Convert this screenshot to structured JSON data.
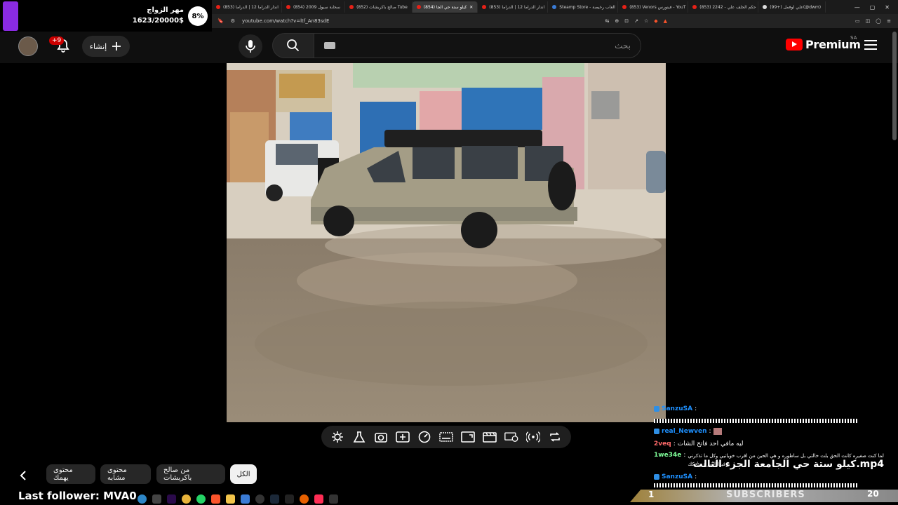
{
  "browser": {
    "tabs": [
      {
        "label": "(853) اندار الدراما 12 | الدراما",
        "active": false
      },
      {
        "label": "(854) سحابة سيول 2009",
        "active": false
      },
      {
        "label": "(852) صالح باكربشات Tube",
        "active": false
      },
      {
        "label": "(854) كيلو ستة حي الجا",
        "active": true
      },
      {
        "label": "(853) اندار الدراما 12 | الدراما",
        "active": false
      },
      {
        "label": "Steamp Store - العاب رخيصة",
        "active": false
      },
      {
        "label": "(853) Venors فينورس - YouT",
        "active": false
      },
      {
        "label": "(853) 2242 - حكم الحلف علي",
        "active": false
      },
      {
        "label": "(99+) علي لوفمل(@dwm)",
        "active": false
      }
    ],
    "url": "youtube.com/watch?v=ltf_An83sdE"
  },
  "widget": {
    "title": "مهر الزواج",
    "value": "1623/20000$",
    "percent": "8%",
    "progress": 0.08,
    "accent": "#8a2be2"
  },
  "youtube": {
    "notification_count": "+9",
    "create_label": "إنشاء",
    "search_placeholder": "بحث",
    "logo_text": "Premium",
    "country_code": "SA",
    "brand_color": "#ff0000"
  },
  "controls": {
    "icons": [
      "settings-icon",
      "flask-icon",
      "camera-icon",
      "add-clip-icon",
      "speed-icon",
      "caption-icon",
      "aspect-icon",
      "film-icon",
      "display-settings-icon",
      "broadcast-icon",
      "loop-icon"
    ]
  },
  "chips": {
    "items": [
      {
        "label": "الكل",
        "active": true
      },
      {
        "label": "من صالح باكربشات",
        "active": false
      },
      {
        "label": "محتوى مشابه",
        "active": false
      },
      {
        "label": "محتوى يهمك",
        "active": false
      }
    ]
  },
  "chat": {
    "messages": [
      {
        "user": "SanzuSA",
        "text": ""
      },
      {
        "user": "real_Newven",
        "text": ""
      },
      {
        "user": "2veq",
        "text": "ليه مافي احد فاتح الشات"
      },
      {
        "user": "1we34e",
        "text": "لما كنت صغيره كانت الحق بلت خالتي بل ساطوره و هي الحين من اقرب خوياتيي وكل ما تذكرني فيها الصرع ضحكك"
      },
      {
        "user": "SanzuSA",
        "text": ""
      }
    ],
    "video_title": "كيلو ستة حي الجامعة الجزء الثالث.mp4"
  },
  "overlay": {
    "last_follower": "Last follower: MVA0",
    "subscribers_label": "SUBSCRIBERS",
    "subscribers_left": "1",
    "subscribers_count": "20"
  }
}
